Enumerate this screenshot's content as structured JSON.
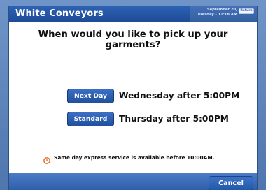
{
  "header": {
    "app_title": "White Conveyors",
    "date_line": "September 20,",
    "time_line": "Tuesday - 11:18 AM",
    "return_label": "Return"
  },
  "main": {
    "question": "When would you like to pick up your garments?",
    "options": [
      {
        "button_label": "Next Day",
        "pickup_text": "Wednesday after 5:00PM"
      },
      {
        "button_label": "Standard",
        "pickup_text": "Thursday after 5:00PM"
      }
    ],
    "notice_text": "Same day express service is available before 10:00AM."
  },
  "footer": {
    "cancel_label": "Cancel"
  },
  "icons": {
    "notice_icon": "clock-icon"
  },
  "colors": {
    "header_blue": "#1d4c98",
    "button_blue": "#2b60b6",
    "clock_orange": "#e2661c"
  }
}
